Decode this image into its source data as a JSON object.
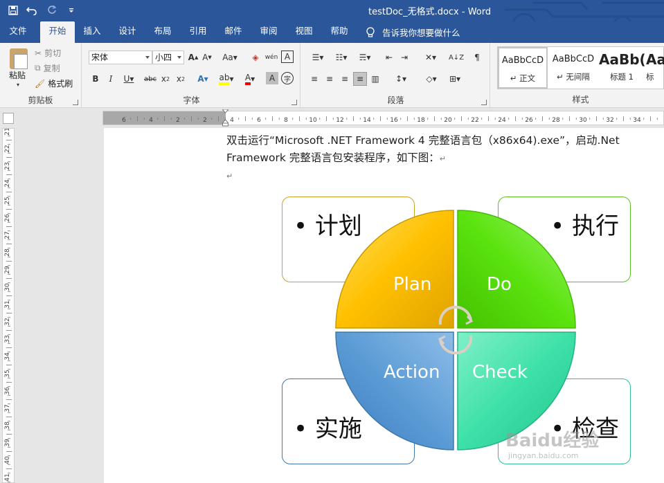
{
  "window": {
    "title": "testDoc_无格式.docx  -  Word"
  },
  "tabs": [
    {
      "label": "文件"
    },
    {
      "label": "开始"
    },
    {
      "label": "插入"
    },
    {
      "label": "设计"
    },
    {
      "label": "布局"
    },
    {
      "label": "引用"
    },
    {
      "label": "邮件"
    },
    {
      "label": "审阅"
    },
    {
      "label": "视图"
    },
    {
      "label": "帮助"
    }
  ],
  "tellme": {
    "label": "告诉我你想要做什么"
  },
  "clipboard": {
    "paste": "粘贴",
    "cut": "剪切",
    "copy": "复制",
    "format_painter": "格式刷",
    "group": "剪贴板"
  },
  "font": {
    "name": "宋体",
    "size": "小四",
    "group": "字体"
  },
  "paragraph": {
    "group": "段落"
  },
  "styles": {
    "group": "样式",
    "items": [
      {
        "sample": "AaBbCcD",
        "name": "↵ 正文"
      },
      {
        "sample": "AaBbCcD",
        "name": "↵ 无间隔"
      },
      {
        "sample": "AaBb(",
        "name": "标题 1"
      },
      {
        "sample": "Aa",
        "name": "标"
      }
    ]
  },
  "ruler": {
    "h_labels": [
      "6",
      "4",
      "2",
      "2",
      "4",
      "6",
      "8",
      "10",
      "12",
      "14",
      "16",
      "18",
      "20",
      "22",
      "24",
      "26",
      "28",
      "30",
      "32",
      "34"
    ],
    "v_labels": [
      "21",
      "22",
      "23",
      "24",
      "25",
      "26",
      "27",
      "28",
      "29",
      "30",
      "31",
      "32",
      "33",
      "34",
      "35",
      "36",
      "37",
      "38",
      "39",
      "40",
      "41"
    ]
  },
  "document": {
    "line1": "双击运行“Microsoft .NET Framework 4 完整语言包（x86x64).exe”，启动.Net",
    "line2": "Framework 完整语言包安装程序，如下图：",
    "mark": "↵"
  },
  "diagram": {
    "boxes": [
      "• 计划",
      "• 执行",
      "• 实施",
      "• 检查"
    ],
    "quadrants": [
      "Plan",
      "Do",
      "Action",
      "Check"
    ],
    "colors": {
      "plan": "#ffc000",
      "do": "#5be30f",
      "action": "#5b9bd5",
      "check": "#3de0a8",
      "plan_border": "#c9a227",
      "do_border": "#5fbf2a",
      "action_border": "#3f77a8",
      "check_border": "#2fbf8b"
    }
  },
  "watermark": {
    "text": "Baidu经验",
    "sub": "jingyan.baidu.com"
  }
}
